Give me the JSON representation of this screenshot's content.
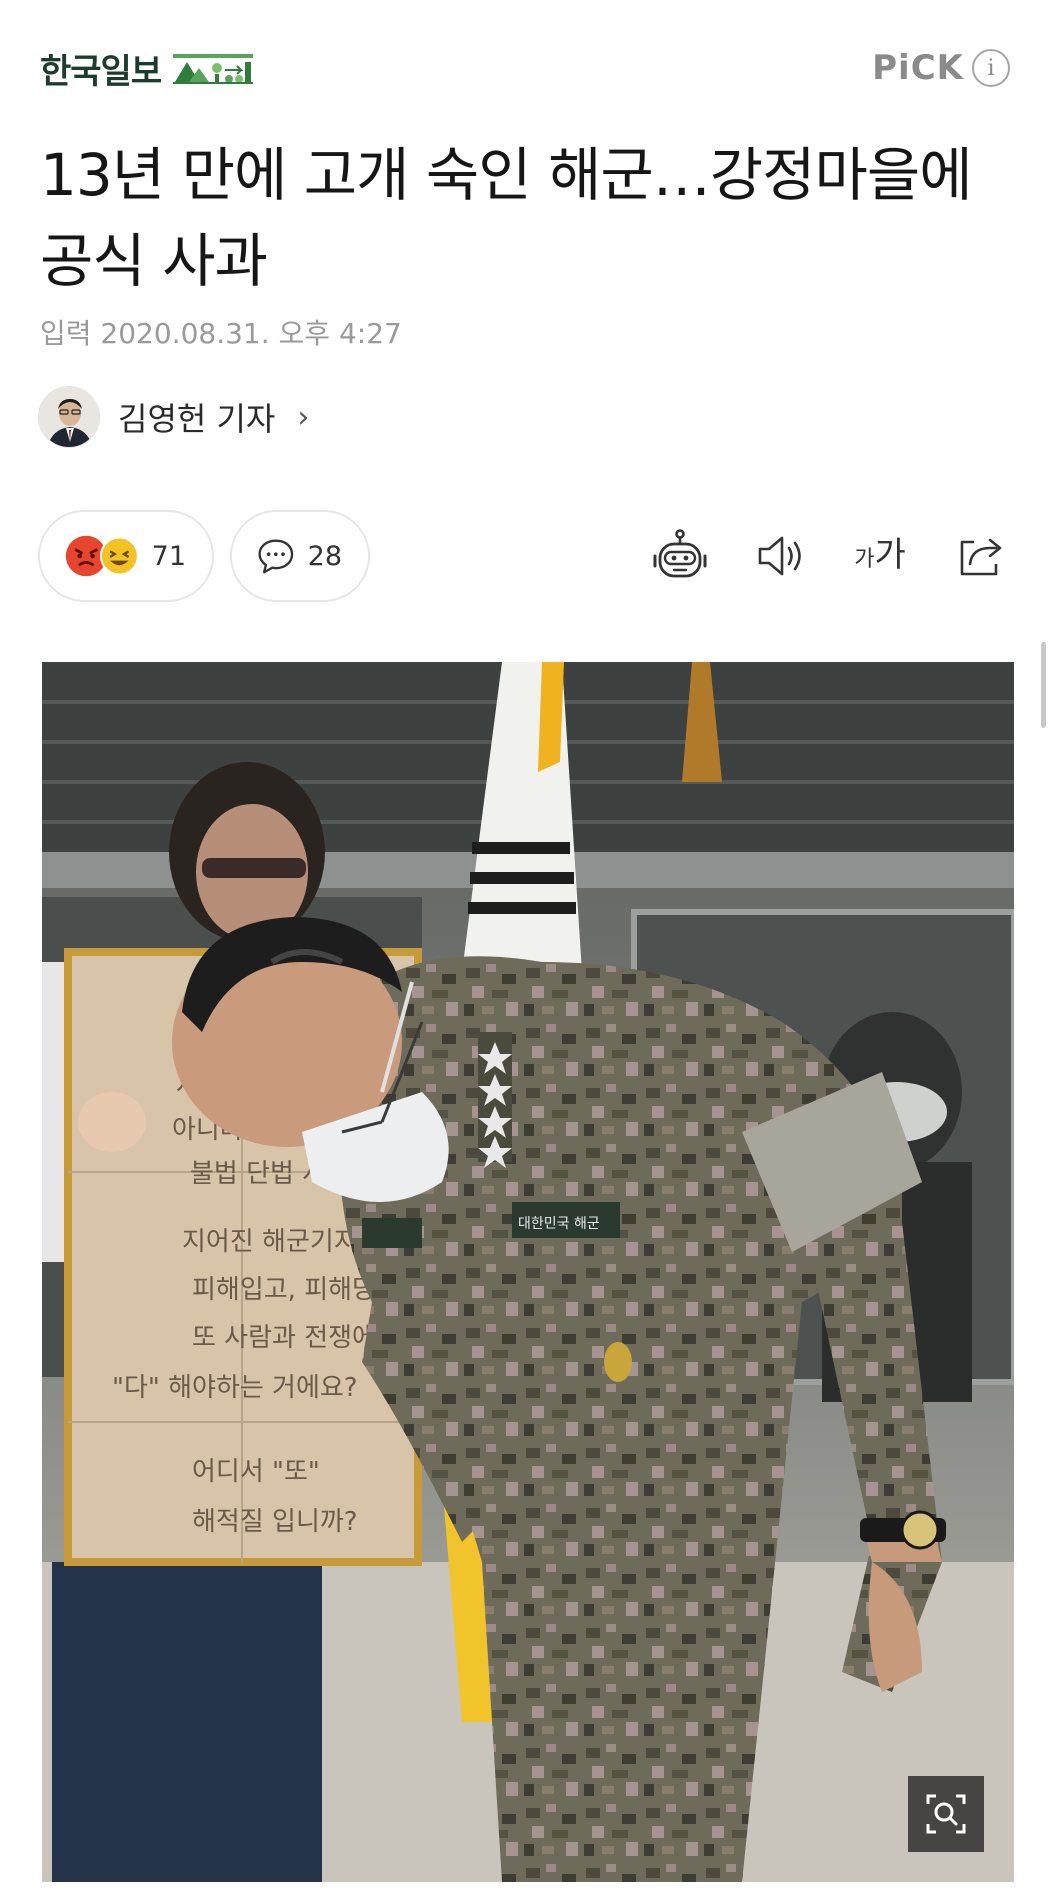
{
  "header": {
    "brand_name": "한국일보",
    "pick_label": "PiCK",
    "info_symbol": "i"
  },
  "article": {
    "title": "13년 만에 고개 숙인 해군…강정마을에 공식 사과",
    "date": "입력 2020.08.31. 오후 4:27",
    "author": "김영헌 기자",
    "author_chevron": "›"
  },
  "actions": {
    "reaction_count": "71",
    "comment_count": "28",
    "font_small": "가",
    "font_big": "가"
  },
  "photo": {
    "sign_lines": [
      "사...",
      "아니라 해군기지",
      "불법 단법 사...",
      "지어진 해군기지",
      "피해입고, 피해당할",
      "또 사람과 전쟁에게",
      "\"다\" 해야하는 거에요?",
      "어디서 \"또\"",
      "해적질 입니까?"
    ],
    "name_tag": "대한민국 해군"
  },
  "colors": {
    "brand_green": "#1c3d2e",
    "pick_gray": "#8a8a8a",
    "date_gray": "#9a9a9a",
    "angry_red": "#e8452e",
    "laugh_yellow": "#f5c226"
  }
}
